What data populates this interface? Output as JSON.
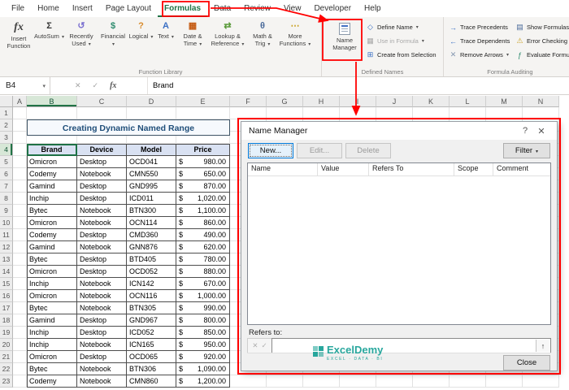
{
  "ribbon": {
    "tabs": [
      "File",
      "Home",
      "Insert",
      "Page Layout",
      "Formulas",
      "Data",
      "Review",
      "View",
      "Developer",
      "Help"
    ],
    "active_tab": "Formulas",
    "function_library": {
      "group_label": "Function Library",
      "insert_function": {
        "label": "Insert Function",
        "glyph": "fx"
      },
      "items": [
        {
          "label": "AutoSum",
          "glyph": "Σ",
          "color": "#333333"
        },
        {
          "label": "Recently Used",
          "glyph": "↺",
          "color": "#7a6fd0"
        },
        {
          "label": "Financial",
          "glyph": "$",
          "color": "#2e8b6e"
        },
        {
          "label": "Logical",
          "glyph": "?",
          "color": "#d88a2a"
        },
        {
          "label": "Text",
          "glyph": "A",
          "color": "#3a6fc4"
        },
        {
          "label": "Date & Time",
          "glyph": "▦",
          "color": "#c55a11"
        },
        {
          "label": "Lookup & Reference",
          "glyph": "⇄",
          "color": "#5a9a3a"
        },
        {
          "label": "Math & Trig",
          "glyph": "θ",
          "color": "#4a6a9a"
        },
        {
          "label": "More Functions",
          "glyph": "⋯",
          "color": "#c9a227"
        }
      ]
    },
    "defined_names": {
      "group_label": "Defined Names",
      "name_manager": {
        "label": "Name Manager"
      },
      "items": [
        {
          "label": "Define Name",
          "glyph": "◇",
          "color": "#3a6fc4",
          "arrow": true,
          "disabled": false
        },
        {
          "label": "Use in Formula",
          "glyph": "▦",
          "color": "#a8a8a8",
          "arrow": true,
          "disabled": true
        },
        {
          "label": "Create from Selection",
          "glyph": "⊞",
          "color": "#3a6fc4",
          "arrow": false,
          "disabled": false
        }
      ]
    },
    "formula_auditing": {
      "group_label": "Formula Auditing",
      "left_items": [
        {
          "label": "Trace Precedents",
          "glyph": "→",
          "color": "#3a6fc4",
          "arrow": false,
          "disabled": false
        },
        {
          "label": "Trace Dependents",
          "glyph": "←",
          "color": "#3a6fc4",
          "arrow": false,
          "disabled": false
        },
        {
          "label": "Remove Arrows",
          "glyph": "✕",
          "color": "#8496b0",
          "arrow": true,
          "disabled": false
        }
      ],
      "right_items": [
        {
          "label": "Show Formulas",
          "glyph": "▤",
          "color": "#4a6a9a",
          "arrow": false,
          "disabled": false
        },
        {
          "label": "Error Checking",
          "glyph": "⚠",
          "color": "#c9a227",
          "arrow": true,
          "disabled": false
        },
        {
          "label": "Evaluate Formula",
          "glyph": "ƒ",
          "color": "#2e8b6e",
          "arrow": false,
          "disabled": false
        }
      ]
    }
  },
  "formula_bar": {
    "name_box": "B4",
    "formula": "Brand"
  },
  "icons": {
    "caret": "▾",
    "cancel": "✕",
    "enter": "✓",
    "fx": "fx",
    "collapse_up": "↑"
  },
  "grid": {
    "columns": [
      "A",
      "B",
      "C",
      "D",
      "E",
      "F",
      "G",
      "H",
      "I",
      "J",
      "K",
      "L",
      "M",
      "N"
    ],
    "row_count": 23,
    "selected_cell": "B4"
  },
  "sheet": {
    "title": "Creating Dynamic Named Range",
    "table": {
      "headers": [
        "Brand",
        "Device",
        "Model",
        "Price"
      ],
      "currency_symbol": "$",
      "rows": [
        [
          "Omicron",
          "Desktop",
          "OCD041",
          "980.00"
        ],
        [
          "Codemy",
          "Notebook",
          "CMN550",
          "650.00"
        ],
        [
          "Gamind",
          "Desktop",
          "GND995",
          "870.00"
        ],
        [
          "Inchip",
          "Desktop",
          "ICD011",
          "1,020.00"
        ],
        [
          "Bytec",
          "Notebook",
          "BTN300",
          "1,100.00"
        ],
        [
          "Omicron",
          "Notebook",
          "OCN114",
          "860.00"
        ],
        [
          "Codemy",
          "Desktop",
          "CMD360",
          "490.00"
        ],
        [
          "Gamind",
          "Notebook",
          "GNN876",
          "620.00"
        ],
        [
          "Bytec",
          "Desktop",
          "BTD405",
          "780.00"
        ],
        [
          "Omicron",
          "Desktop",
          "OCD052",
          "880.00"
        ],
        [
          "Inchip",
          "Notebook",
          "ICN142",
          "670.00"
        ],
        [
          "Omicron",
          "Notebook",
          "OCN116",
          "1,000.00"
        ],
        [
          "Bytec",
          "Notebook",
          "BTN305",
          "990.00"
        ],
        [
          "Gamind",
          "Desktop",
          "GND967",
          "800.00"
        ],
        [
          "Inchip",
          "Desktop",
          "ICD052",
          "850.00"
        ],
        [
          "Inchip",
          "Notebook",
          "ICN165",
          "950.00"
        ],
        [
          "Omicron",
          "Desktop",
          "OCD065",
          "920.00"
        ],
        [
          "Bytec",
          "Notebook",
          "BTN306",
          "1,090.00"
        ],
        [
          "Codemy",
          "Notebook",
          "CMN860",
          "1,200.00"
        ]
      ]
    }
  },
  "dialog": {
    "title": "Name Manager",
    "help_icon": "?",
    "close_icon": "✕",
    "buttons": {
      "new": "New...",
      "edit": "Edit...",
      "delete": "Delete",
      "filter": "Filter",
      "close": "Close"
    },
    "list_columns": [
      "Name",
      "Value",
      "Refers To",
      "Scope",
      "Comment"
    ],
    "refers_to_label": "Refers to:"
  },
  "watermark": {
    "name": "ExcelDemy",
    "tagline": "EXCEL · DATA · BI",
    "color": "#16a095"
  },
  "annotation_color": "#ff0000"
}
